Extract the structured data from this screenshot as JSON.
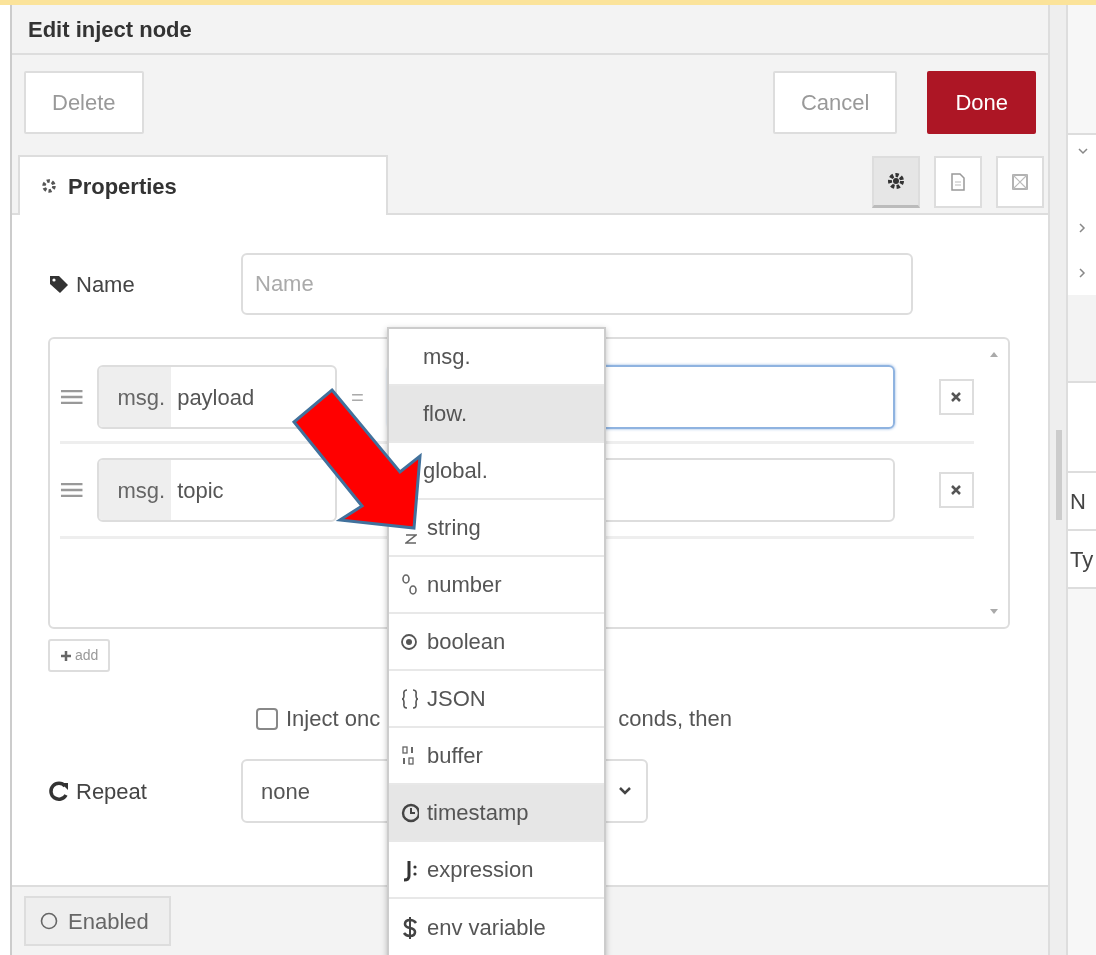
{
  "dialog": {
    "title": "Edit inject node"
  },
  "buttons": [
    {
      "label": "Delete",
      "kind": "plain"
    },
    {
      "label": "Cancel",
      "kind": "plain"
    },
    {
      "label": "Done",
      "kind": "primary"
    }
  ],
  "tabs": [
    {
      "label": "Properties",
      "selected": true
    }
  ],
  "tab_icons": [
    {
      "kind": "gear",
      "selected": true
    },
    {
      "kind": "document",
      "selected": false
    },
    {
      "kind": "frame",
      "selected": false
    }
  ],
  "name_field": {
    "label": "Name",
    "placeholder": "Name"
  },
  "properties": [
    {
      "prefix": "msg.",
      "key": "payload",
      "operator": "=",
      "focused": true
    },
    {
      "prefix": "msg.",
      "key": "topic",
      "focused": false
    }
  ],
  "add_button": "add",
  "inject_once": {
    "checked": false,
    "label_start": "Inject onc",
    "label_end": "conds, then"
  },
  "repeat": {
    "label": "Repeat",
    "value": "none"
  },
  "enabled_button": "Enabled",
  "type_menu": [
    {
      "label": "msg.",
      "kind": "plain",
      "selected": false
    },
    {
      "label": "flow.",
      "kind": "plain",
      "selected": true
    },
    {
      "label": "global.",
      "kind": "plain",
      "selected": false
    },
    {
      "label": "string",
      "kind": "string",
      "selected": false
    },
    {
      "label": "number",
      "kind": "number",
      "selected": false
    },
    {
      "label": "boolean",
      "kind": "boolean",
      "selected": false
    },
    {
      "label": "JSON",
      "kind": "json",
      "selected": false
    },
    {
      "label": "buffer",
      "kind": "buffer",
      "selected": false
    },
    {
      "label": "timestamp",
      "kind": "timestamp",
      "selected": true
    },
    {
      "label": "expression",
      "kind": "expression",
      "selected": false
    },
    {
      "label": "env variable",
      "kind": "env",
      "selected": false
    }
  ],
  "side_panel": {
    "texts": [
      "N",
      "Ty"
    ]
  }
}
